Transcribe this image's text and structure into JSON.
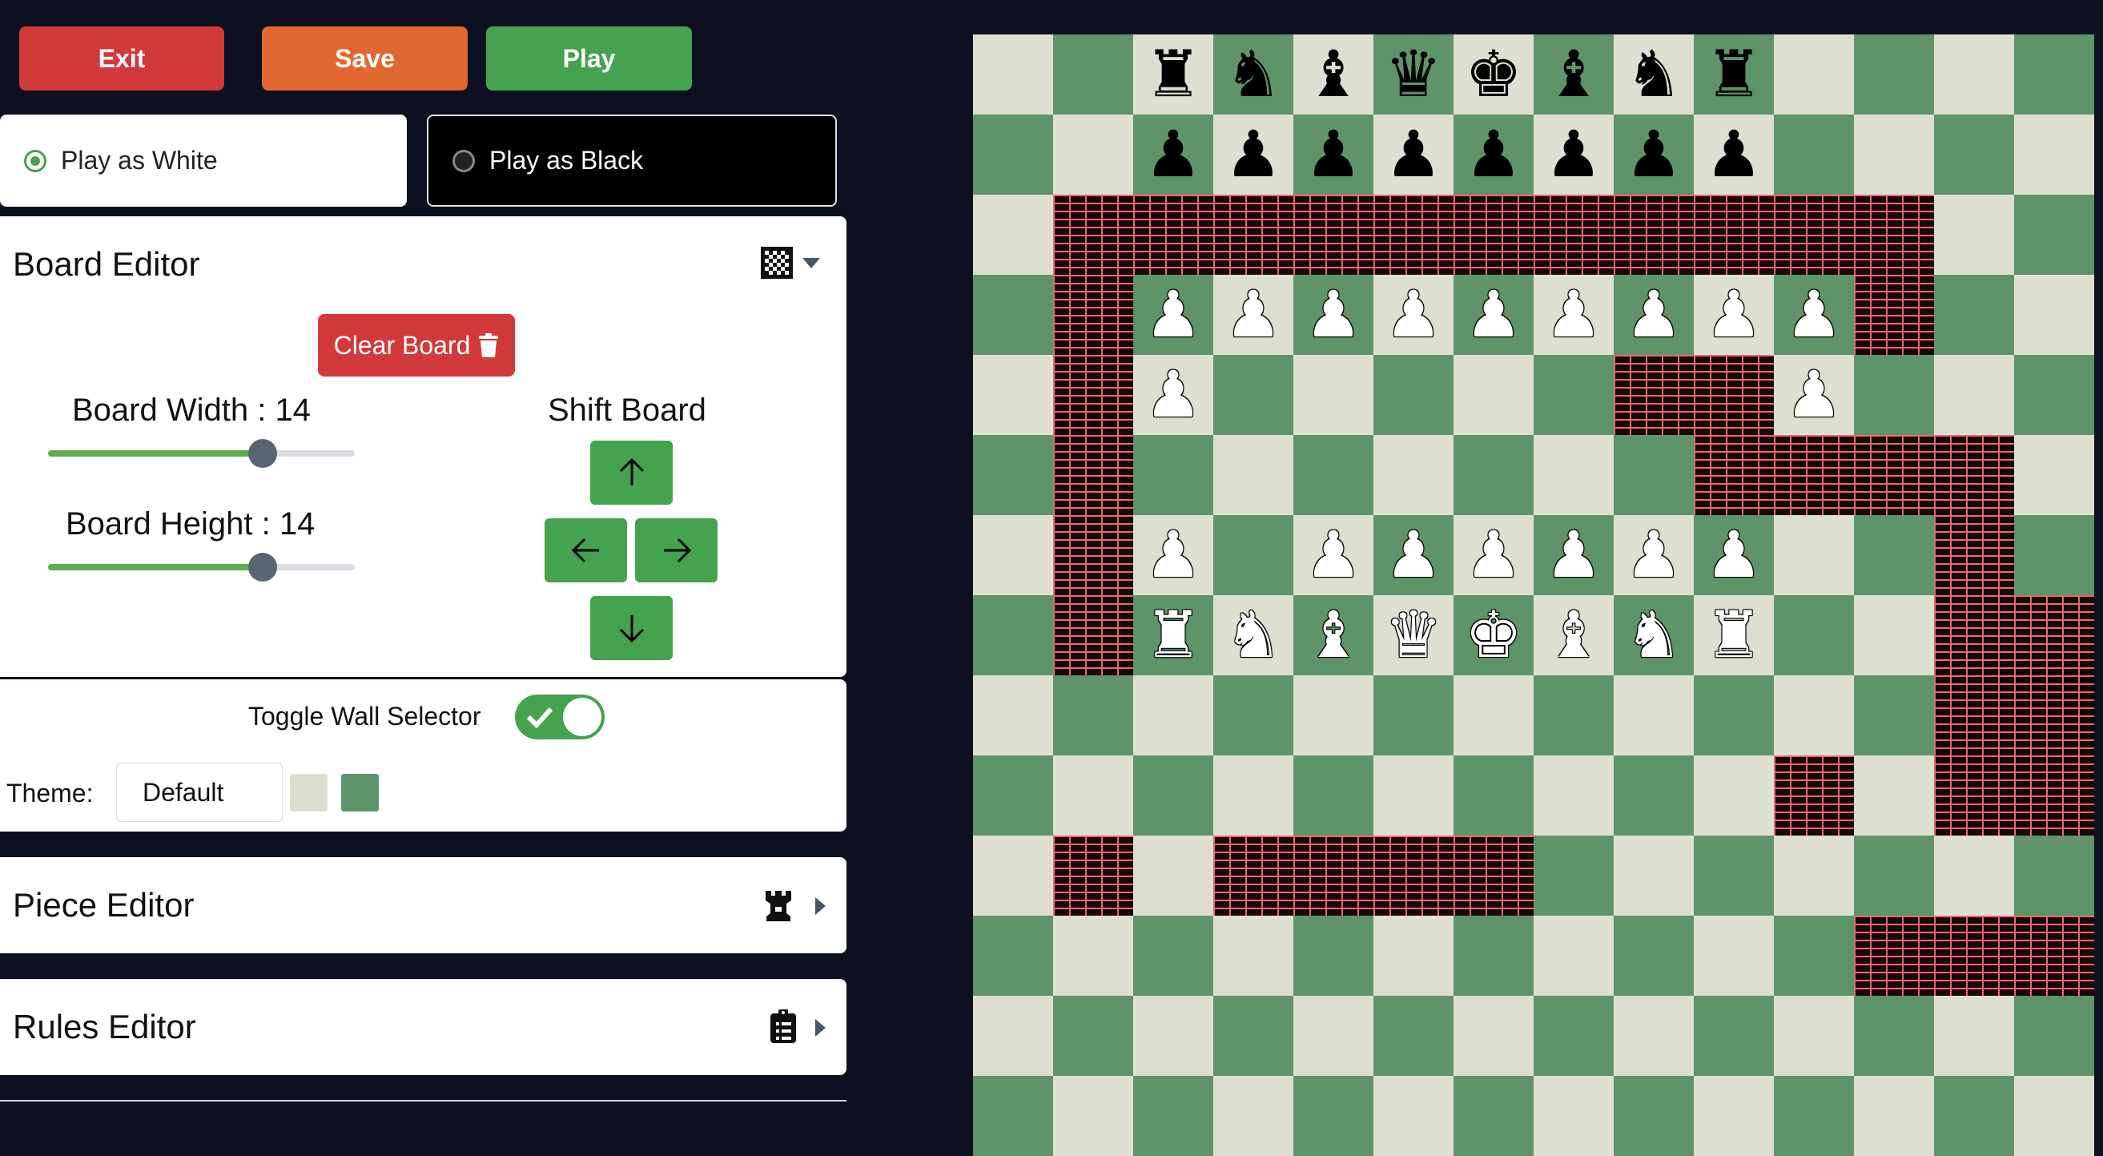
{
  "toolbar": {
    "exit_label": "Exit",
    "save_label": "Save",
    "play_label": "Play"
  },
  "play_as": {
    "white_label": "Play as White",
    "black_label": "Play as Black",
    "selected": "white"
  },
  "board_editor": {
    "title": "Board Editor",
    "clear_label": "Clear Board",
    "width_label": "Board Width : 14",
    "width_value": 14,
    "height_label": "Board Height : 14",
    "height_value": 14,
    "slider_max": 20,
    "shift_label": "Shift Board",
    "toggle_wall_label": "Toggle Wall Selector",
    "toggle_wall_on": true,
    "theme_label": "Theme:",
    "theme_value": "Default",
    "theme_light_color": "#dfdfd1",
    "theme_dark_color": "#5f946a"
  },
  "piece_editor": {
    "title": "Piece Editor"
  },
  "rules_editor": {
    "title": "Rules Editor"
  },
  "board": {
    "rows": [
      "..rnbqkbnr....",
      "..pppppppp....",
      ".WWWWWWWWWWW..",
      ".WPPPPPPPPPW..",
      ".WP.....WWP...",
      ".W.......WWWW.",
      ".WP.PPPPPP..W.",
      ".WRNBQKBNR..WW",
      "............WW",
      "..........W.WW",
      ".W.WWWW.......",
      "...........WWW",
      "..............",
      ".............."
    ],
    "piece_symbols": {
      "r": "♜",
      "n": "♞",
      "b": "♝",
      "q": "♛",
      "k": "♚",
      "p": "♟",
      "R": "♜",
      "N": "♞",
      "B": "♝",
      "Q": "♛",
      "K": "♚",
      "P": "♟"
    }
  }
}
